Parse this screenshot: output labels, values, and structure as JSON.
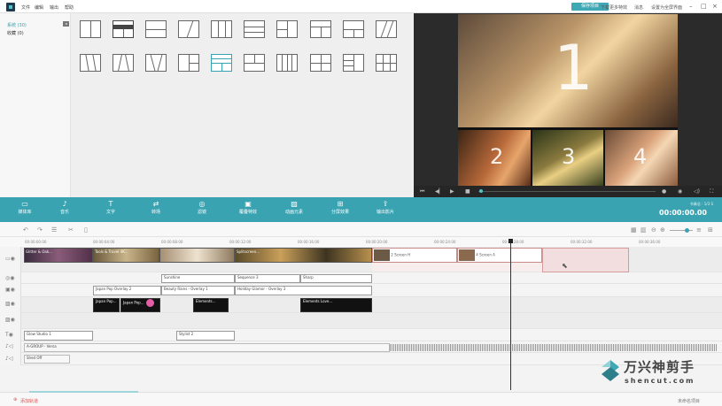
{
  "menu": [
    "文件",
    "编辑",
    "输出",
    "帮助"
  ],
  "header": {
    "save_label": "保存项目",
    "links": [
      "下载更多特效",
      "消息",
      "设置为全屏界面"
    ]
  },
  "sidebar": {
    "items": [
      {
        "label": "系统 (30)",
        "active": true
      },
      {
        "label": "收藏 (0)",
        "active": false
      }
    ]
  },
  "toolbar": {
    "items": [
      "媒体库",
      "音乐",
      "文字",
      "转场",
      "滤镜",
      "覆叠特效",
      "动画元素",
      "分屏效果",
      "输出影片"
    ]
  },
  "player": {
    "duration_label": "节奏总 : 1/3 S",
    "timecode": "00:00:00.00",
    "overlay_numbers": [
      "1",
      "2",
      "3",
      "4"
    ]
  },
  "ruler": {
    "marks": [
      "00:00:00:00",
      "00:00:04:00",
      "00:00:08:00",
      "00:00:12:00",
      "00:00:16:00",
      "00:00:20:00",
      "00:00:24:00",
      "00:00:28:00",
      "00:00:32:00",
      "00:00:36:00"
    ]
  },
  "tracks": {
    "video_clips": [
      "Glitter & Oak...",
      "Tools & Travel 4K...",
      "",
      "Splitscreen...",
      "2 Screen H",
      "4 Screen A"
    ],
    "filter_clips": [
      "Sunshine",
      "Sequence 3",
      "Sharp"
    ],
    "overlay_clips": [
      "Japan Pop Overlay 2",
      "Beauty Rains - Overlay 1",
      "Holiday Glamor - Overlay 3"
    ],
    "element_clips": [
      "Japan Pop...",
      "Japan Pop...",
      "Elements...",
      "Elements Love..."
    ],
    "text_clips": [
      "Glow Studio 1",
      "Stylist 2"
    ],
    "audio_clips": [
      "A-GROUP - Versa",
      "Shed Off"
    ]
  },
  "footer": {
    "add_track": "添加轨道",
    "unsaved": "未命名项目"
  },
  "watermark": {
    "name": "万兴神剪手",
    "url": "shencut.com"
  },
  "colors": {
    "accent": "#3aa3b1",
    "brand_dark": "#1d3a4e"
  }
}
